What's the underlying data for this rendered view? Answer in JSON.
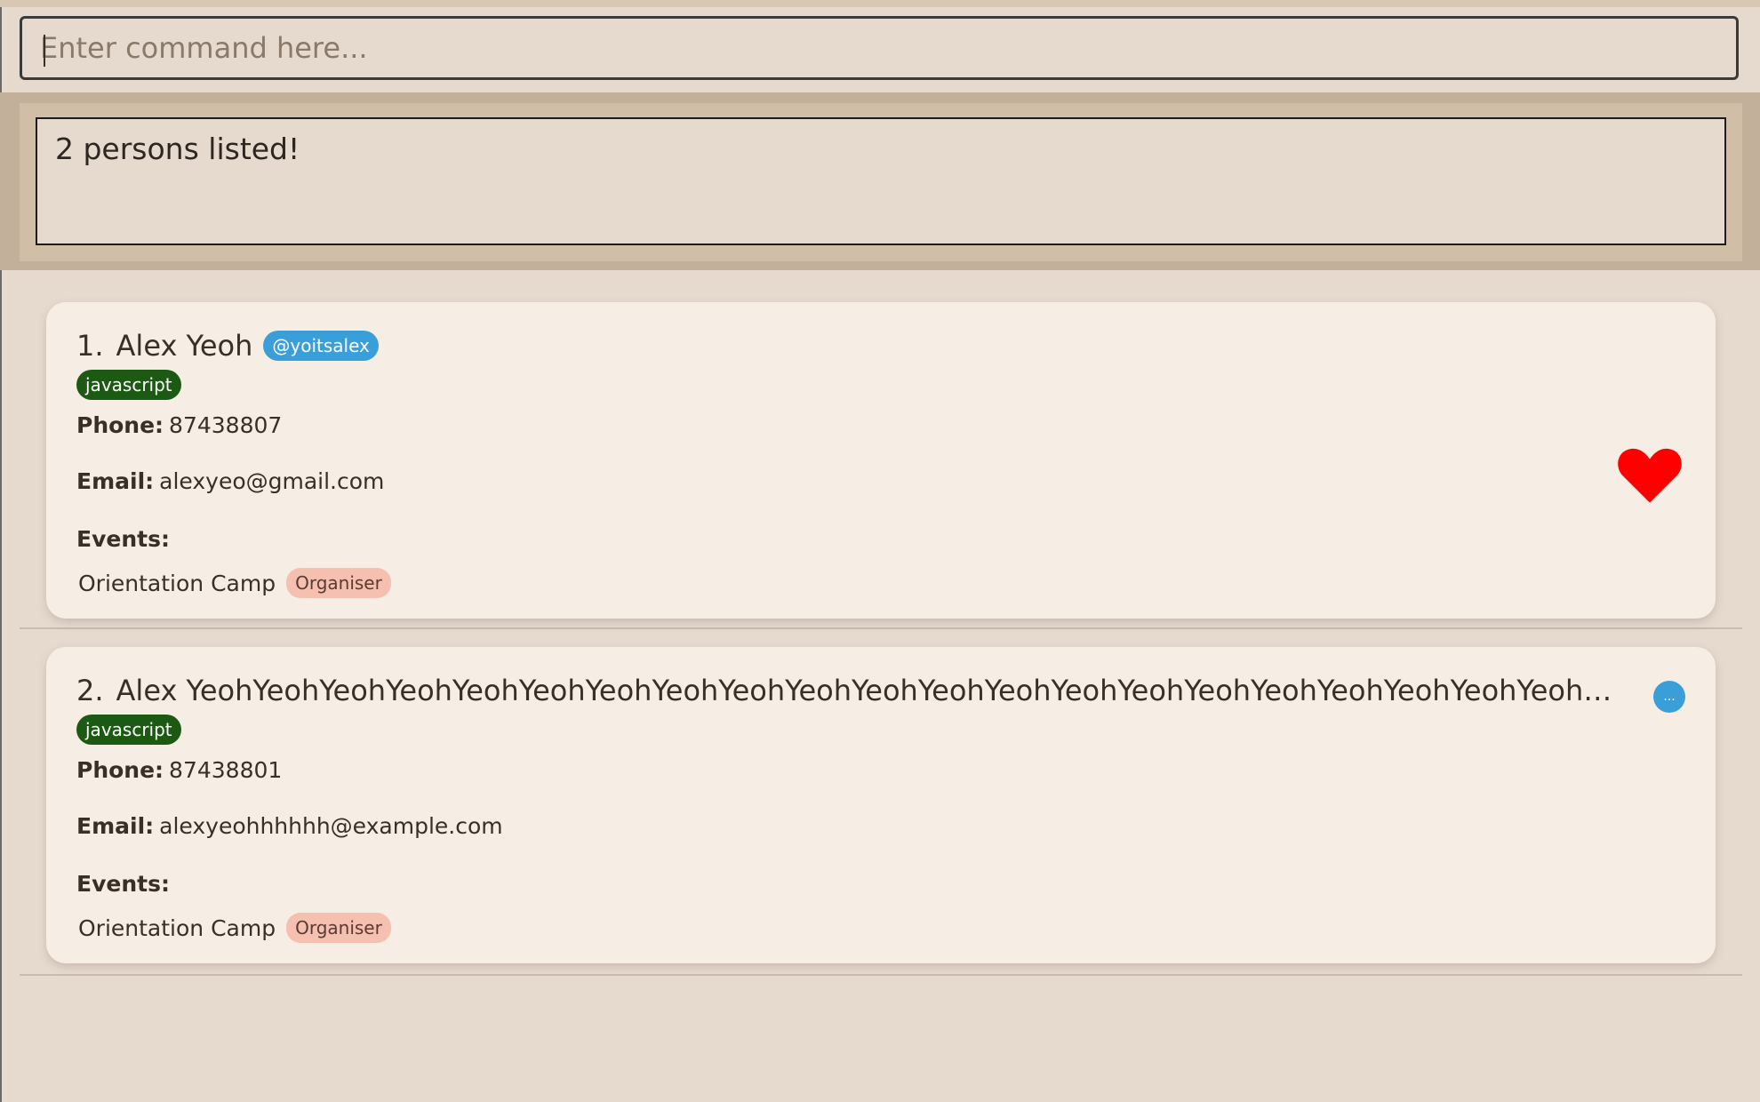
{
  "command": {
    "placeholder": "Enter command here..."
  },
  "result": {
    "message": "2 persons listed!"
  },
  "persons": [
    {
      "index": "1.",
      "name": "Alex Yeoh",
      "handle": "@yoitsalex",
      "tag": "javascript",
      "phone_label": "Phone:",
      "phone": "87438807",
      "email_label": "Email:",
      "email": "alexyeo@gmail.com",
      "events_label": "Events:",
      "event": "Orientation Camp",
      "role": "Organiser",
      "favorite_icon": "heart-icon",
      "favorite_color": "#ff0000"
    },
    {
      "index": "2.",
      "name": "Alex YeohYeohYeohYeohYeohYeohYeohYeohYeohYeohYeohYeohYeohYeohYeohYeohYeohYeohYeohYeohYeohYeoh...",
      "more_label": "...",
      "tag": "javascript",
      "phone_label": "Phone:",
      "phone": "87438801",
      "email_label": "Email:",
      "email": "alexyeohhhhhh@example.com",
      "events_label": "Events:",
      "event": "Orientation Camp",
      "role": "Organiser"
    }
  ],
  "colors": {
    "handle_badge": "#3a9fd9",
    "tag_badge": "#1c5a14",
    "role_badge": "#f5c0b0",
    "background": "#e6dacf",
    "card": "#f6ede4"
  }
}
